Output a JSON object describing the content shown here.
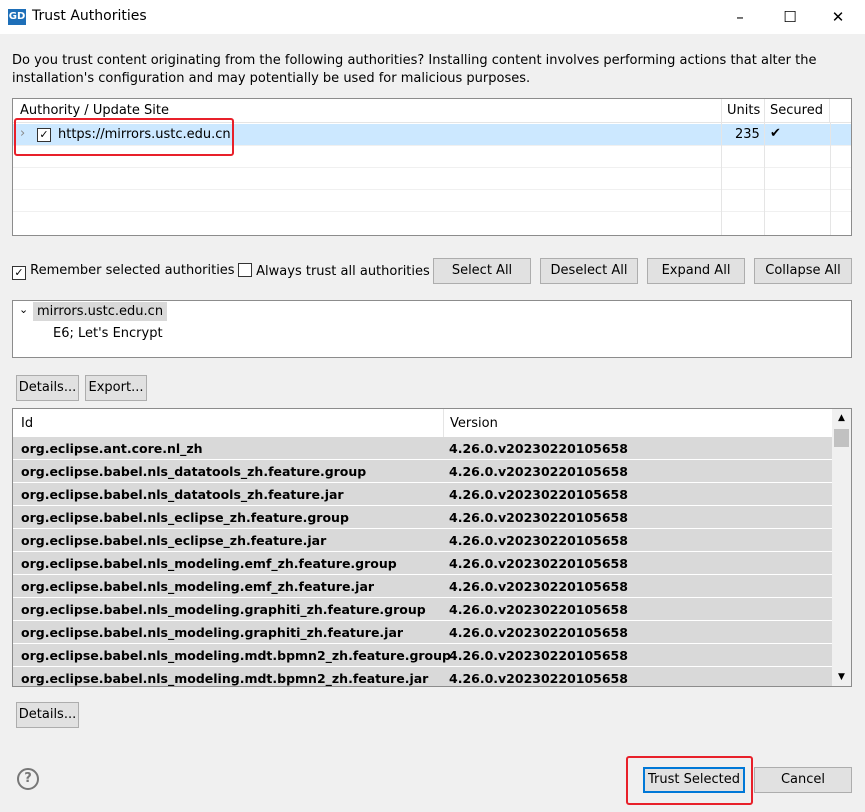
{
  "window": {
    "title": "Trust Authorities",
    "icon_text": "GD",
    "minimize": "–",
    "maximize": "☐",
    "close": "✕"
  },
  "intro": [
    "Do you trust content originating from the following authorities?  Installing content involves performing actions that alter the",
    "installation's configuration and may potentially be used for malicious purposes."
  ],
  "authorities": {
    "headers": [
      "Authority / Update Site",
      "Units",
      "Secured"
    ],
    "rows": [
      {
        "site": "https://mirrors.ustc.edu.cn",
        "units": "235",
        "secured": "✔",
        "checked": true
      }
    ]
  },
  "options": {
    "remember": "Remember selected authorities",
    "always_trust": "Always trust all authorities",
    "select_all": "Select All",
    "deselect_all": "Deselect All",
    "expand_all": "Expand All",
    "collapse_all": "Collapse All"
  },
  "certs": {
    "root": "mirrors.ustc.edu.cn",
    "child": "E6; Let's Encrypt"
  },
  "cert_buttons": {
    "details": "Details...",
    "export": "Export..."
  },
  "units": {
    "headers": [
      "Id",
      "Version"
    ],
    "rows": [
      {
        "id": "org.eclipse.ant.core.nl_zh",
        "version": "4.26.0.v20230220105658"
      },
      {
        "id": "org.eclipse.babel.nls_datatools_zh.feature.group",
        "version": "4.26.0.v20230220105658"
      },
      {
        "id": "org.eclipse.babel.nls_datatools_zh.feature.jar",
        "version": "4.26.0.v20230220105658"
      },
      {
        "id": "org.eclipse.babel.nls_eclipse_zh.feature.group",
        "version": "4.26.0.v20230220105658"
      },
      {
        "id": "org.eclipse.babel.nls_eclipse_zh.feature.jar",
        "version": "4.26.0.v20230220105658"
      },
      {
        "id": "org.eclipse.babel.nls_modeling.emf_zh.feature.group",
        "version": "4.26.0.v20230220105658"
      },
      {
        "id": "org.eclipse.babel.nls_modeling.emf_zh.feature.jar",
        "version": "4.26.0.v20230220105658"
      },
      {
        "id": "org.eclipse.babel.nls_modeling.graphiti_zh.feature.group",
        "version": "4.26.0.v20230220105658"
      },
      {
        "id": "org.eclipse.babel.nls_modeling.graphiti_zh.feature.jar",
        "version": "4.26.0.v20230220105658"
      },
      {
        "id": "org.eclipse.babel.nls_modeling.mdt.bpmn2_zh.feature.group",
        "version": "4.26.0.v20230220105658"
      },
      {
        "id": "org.eclipse.babel.nls_modeling.mdt.bpmn2_zh.feature.jar",
        "version": "4.26.0.v20230220105658"
      }
    ]
  },
  "unit_details": "Details...",
  "footer": {
    "help": "?",
    "trust_selected": "Trust Selected",
    "cancel": "Cancel"
  }
}
